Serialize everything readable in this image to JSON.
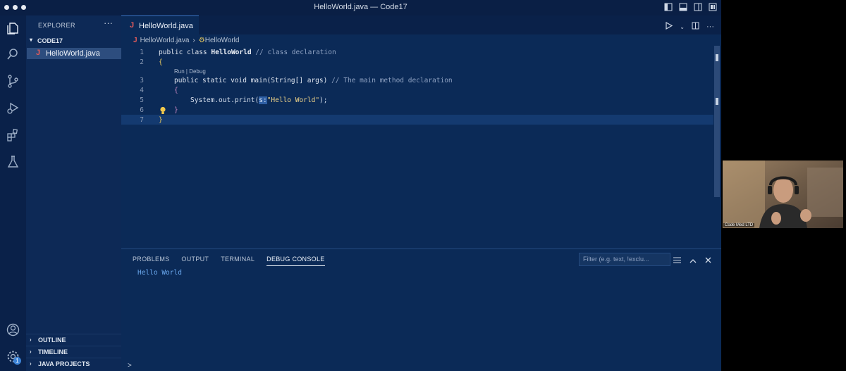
{
  "window": {
    "title": "HelloWorld.java — Code17"
  },
  "sidebar": {
    "title": "EXPLORER",
    "more_label": "···",
    "folder": "CODE17",
    "file": "HelloWorld.java",
    "sections": [
      "OUTLINE",
      "TIMELINE",
      "JAVA PROJECTS"
    ]
  },
  "activity": {
    "badge_count": "1"
  },
  "editor": {
    "tab_label": "HelloWorld.java",
    "breadcrumb": [
      "HelloWorld.java",
      "HelloWorld"
    ],
    "codelens": "Run | Debug",
    "line_numbers": [
      "1",
      "2",
      "3",
      "4",
      "5",
      "6",
      "7"
    ],
    "lines": {
      "l1_kw": "public class ",
      "l1_cls": "HelloWorld",
      "l1_cmt": " // class declaration",
      "l2": "{",
      "l3_code": "public static void main(String[] args)",
      "l3_cmt": " // The main method declaration",
      "l4": "{",
      "l5_pre": "System.out.print(",
      "l5_hint": "s:",
      "l5_str": "\"Hello World\"",
      "l5_post": ");",
      "l6": "}",
      "l7": "}"
    }
  },
  "panel": {
    "tabs": [
      "PROBLEMS",
      "OUTPUT",
      "TERMINAL",
      "DEBUG CONSOLE"
    ],
    "active_tab": "DEBUG CONSOLE",
    "filter_placeholder": "Filter (e.g. text, !exclu...",
    "output": "Hello World",
    "input_prompt": ">"
  },
  "webcam": {
    "label": "Code Med LTD"
  },
  "colors": {
    "accent": "#3a74c4",
    "background": "#0b2a57",
    "string": "#f1d58a",
    "java": "#e25b5b"
  }
}
